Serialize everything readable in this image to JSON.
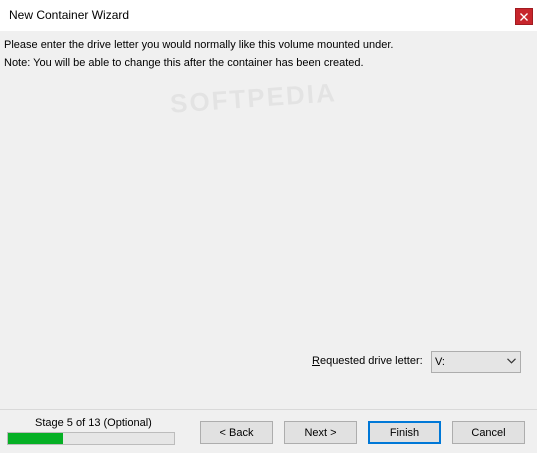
{
  "window": {
    "title": "New Container Wizard",
    "close_icon": "close-icon"
  },
  "content": {
    "instruction": "Please enter the drive letter you would normally like this volume mounted under.",
    "note": "Note: You will be able to change this after the container has been created.",
    "watermark": "SOFTPEDIA"
  },
  "drive": {
    "label_underlined": "R",
    "label_rest": "equested drive letter:",
    "selected": "V:",
    "dropdown_icon": "chevron-down-icon"
  },
  "footer": {
    "stage_text": "Stage 5 of 13 (Optional)",
    "progress_percent": 33
  },
  "buttons": {
    "back": "< Back",
    "next": "Next >",
    "finish": "Finish",
    "cancel": "Cancel"
  },
  "colors": {
    "progress_fill": "#06b025",
    "close_button": "#c7252c",
    "default_button_border": "#0078d7"
  }
}
